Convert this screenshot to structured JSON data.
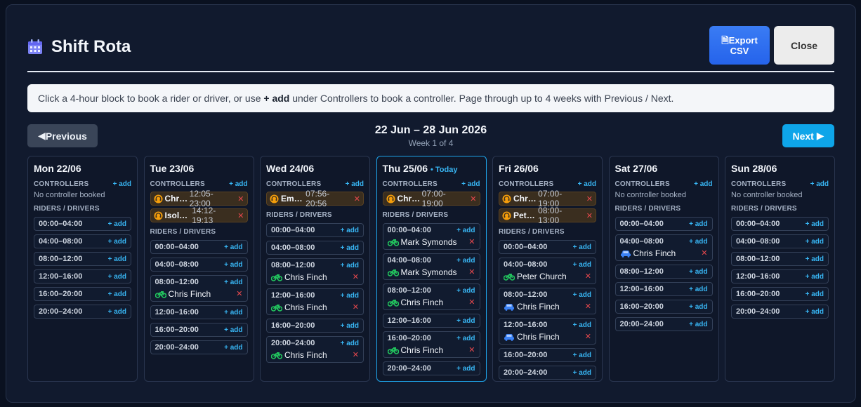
{
  "header": {
    "title": "Shift Rota",
    "export_label_1": "Export",
    "export_label_2": "CSV",
    "close_label": "Close"
  },
  "info": {
    "pre": "Click a 4-hour block to book a rider or driver, or use ",
    "bold": "+ add",
    "post": " under Controllers to book a controller. Page through up to 4 weeks with Previous / Next."
  },
  "nav": {
    "prev": "Previous",
    "next": "Next",
    "range": "22 Jun – 28 Jun 2026",
    "sub": "Week 1 of 4"
  },
  "labels": {
    "controllers": "CONTROLLERS",
    "riders": "RIDERS / DRIVERS",
    "add": "+ add",
    "no_controller": "No controller booked",
    "today": "• Today",
    "remove": "✕"
  },
  "colors": {
    "accent": "#38b6f4",
    "bike": "#22c55e",
    "car": "#3b82f6",
    "controller": "#f59e0b",
    "remove": "#e5484d"
  },
  "days": [
    {
      "title": "Mon 22/06",
      "today": false,
      "controllers": [],
      "slots": [
        {
          "time": "00:00–04:00"
        },
        {
          "time": "04:00–08:00"
        },
        {
          "time": "08:00–12:00"
        },
        {
          "time": "12:00–16:00"
        },
        {
          "time": "16:00–20:00"
        },
        {
          "time": "20:00–24:00"
        }
      ]
    },
    {
      "title": "Tue 23/06",
      "today": false,
      "controllers": [
        {
          "name": "Chri…",
          "time": "12:05-23:00"
        },
        {
          "name": "Isolde…",
          "time": "14:12-19:13"
        }
      ],
      "slots": [
        {
          "time": "00:00–04:00"
        },
        {
          "time": "04:00–08:00"
        },
        {
          "time": "08:00–12:00",
          "who": "Chris Finch",
          "icon": "bike-icon"
        },
        {
          "time": "12:00–16:00"
        },
        {
          "time": "16:00–20:00"
        },
        {
          "time": "20:00–24:00"
        }
      ]
    },
    {
      "title": "Wed 24/06",
      "today": false,
      "controllers": [
        {
          "name": "Em…",
          "time": "07:56-20:56"
        }
      ],
      "slots": [
        {
          "time": "00:00–04:00"
        },
        {
          "time": "04:00–08:00"
        },
        {
          "time": "08:00–12:00",
          "who": "Chris Finch",
          "icon": "bike-icon"
        },
        {
          "time": "12:00–16:00",
          "who": "Chris Finch",
          "icon": "bike-icon"
        },
        {
          "time": "16:00–20:00"
        },
        {
          "time": "20:00–24:00",
          "who": "Chris Finch",
          "icon": "bike-icon"
        }
      ]
    },
    {
      "title": "Thu 25/06",
      "today": true,
      "controllers": [
        {
          "name": "Chri…",
          "time": "07:00-19:00"
        }
      ],
      "slots": [
        {
          "time": "00:00–04:00",
          "who": "Mark Symonds",
          "icon": "bike-icon"
        },
        {
          "time": "04:00–08:00",
          "who": "Mark Symonds",
          "icon": "bike-icon"
        },
        {
          "time": "08:00–12:00",
          "who": "Chris Finch",
          "icon": "bike-icon"
        },
        {
          "time": "12:00–16:00"
        },
        {
          "time": "16:00–20:00",
          "who": "Chris Finch",
          "icon": "bike-icon"
        },
        {
          "time": "20:00–24:00"
        }
      ]
    },
    {
      "title": "Fri 26/06",
      "today": false,
      "controllers": [
        {
          "name": "Chri…",
          "time": "07:00-19:00"
        },
        {
          "name": "Pete…",
          "time": "08:00-13:00"
        }
      ],
      "slots": [
        {
          "time": "00:00–04:00"
        },
        {
          "time": "04:00–08:00",
          "who": "Peter Church",
          "icon": "bike-icon"
        },
        {
          "time": "08:00–12:00",
          "who": "Chris Finch",
          "icon": "car-icon"
        },
        {
          "time": "12:00–16:00",
          "who": "Chris Finch",
          "icon": "car-icon"
        },
        {
          "time": "16:00–20:00"
        },
        {
          "time": "20:00–24:00"
        }
      ]
    },
    {
      "title": "Sat 27/06",
      "today": false,
      "controllers": [],
      "slots": [
        {
          "time": "00:00–04:00"
        },
        {
          "time": "04:00–08:00",
          "who": "Chris Finch",
          "icon": "car-icon"
        },
        {
          "time": "08:00–12:00"
        },
        {
          "time": "12:00–16:00"
        },
        {
          "time": "16:00–20:00"
        },
        {
          "time": "20:00–24:00"
        }
      ]
    },
    {
      "title": "Sun 28/06",
      "today": false,
      "controllers": [],
      "slots": [
        {
          "time": "00:00–04:00"
        },
        {
          "time": "04:00–08:00"
        },
        {
          "time": "08:00–12:00"
        },
        {
          "time": "12:00–16:00"
        },
        {
          "time": "16:00–20:00"
        },
        {
          "time": "20:00–24:00"
        }
      ]
    }
  ]
}
